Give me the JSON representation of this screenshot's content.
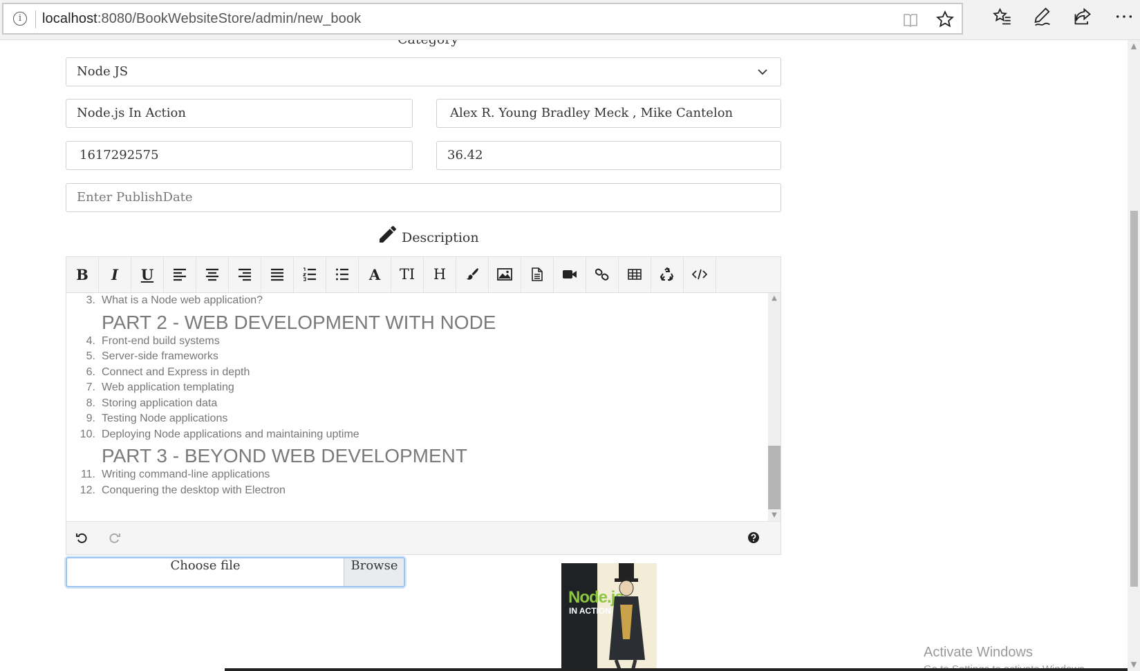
{
  "browser": {
    "url_host": "localhost",
    "url_path": ":8080/BookWebsiteStore/admin/new_book",
    "icons": [
      "info-icon",
      "reading-view-icon",
      "favorite-star-icon",
      "favorites-list-icon",
      "pen-notes-icon",
      "share-icon",
      "more-icon"
    ]
  },
  "form": {
    "category_label": "Category",
    "category_selected": "Node JS",
    "title_value": "Node.js In Action",
    "author_value": "Alex R. Young Bradley Meck , Mike Cantelon",
    "isbn_value": "1617292575",
    "price_value": "36.42",
    "publish_date_placeholder": "Enter PublishDate",
    "description_label": "Description"
  },
  "editor": {
    "toolbar": [
      "bold",
      "italic",
      "underline",
      "align-left",
      "align-center",
      "align-right",
      "justify",
      "ordered-list",
      "unordered-list",
      "font-family",
      "font-size",
      "heading",
      "color",
      "image",
      "file",
      "video",
      "link",
      "table",
      "clear-formatting",
      "code-view"
    ],
    "content": [
      {
        "type": "item",
        "num": "3.",
        "text": "What is a Node web application?"
      },
      {
        "type": "heading",
        "text": "PART 2 - WEB DEVELOPMENT WITH NODE"
      },
      {
        "type": "item",
        "num": "4.",
        "text": "Front-end build systems"
      },
      {
        "type": "item",
        "num": "5.",
        "text": "Server-side frameworks"
      },
      {
        "type": "item",
        "num": "6.",
        "text": "Connect and Express in depth"
      },
      {
        "type": "item",
        "num": "7.",
        "text": "Web application templating"
      },
      {
        "type": "item",
        "num": "8.",
        "text": "Storing application data"
      },
      {
        "type": "item",
        "num": "9.",
        "text": "Testing Node applications"
      },
      {
        "type": "item",
        "num": "10.",
        "text": "Deploying Node applications and maintaining uptime"
      },
      {
        "type": "heading",
        "text": "PART 3 - BEYOND WEB DEVELOPMENT"
      },
      {
        "type": "item",
        "num": "11.",
        "text": "Writing command-line applications"
      },
      {
        "type": "item",
        "num": "12.",
        "text": "Conquering the desktop with Electron"
      }
    ]
  },
  "file_input": {
    "choose_label": "Choose file",
    "browse_label": "Browse"
  },
  "cover": {
    "title": "Node.js",
    "subtitle": "IN ACTION"
  },
  "watermark": {
    "title": "Activate Windows",
    "subtitle": "Go to Settings to activate Windows."
  }
}
